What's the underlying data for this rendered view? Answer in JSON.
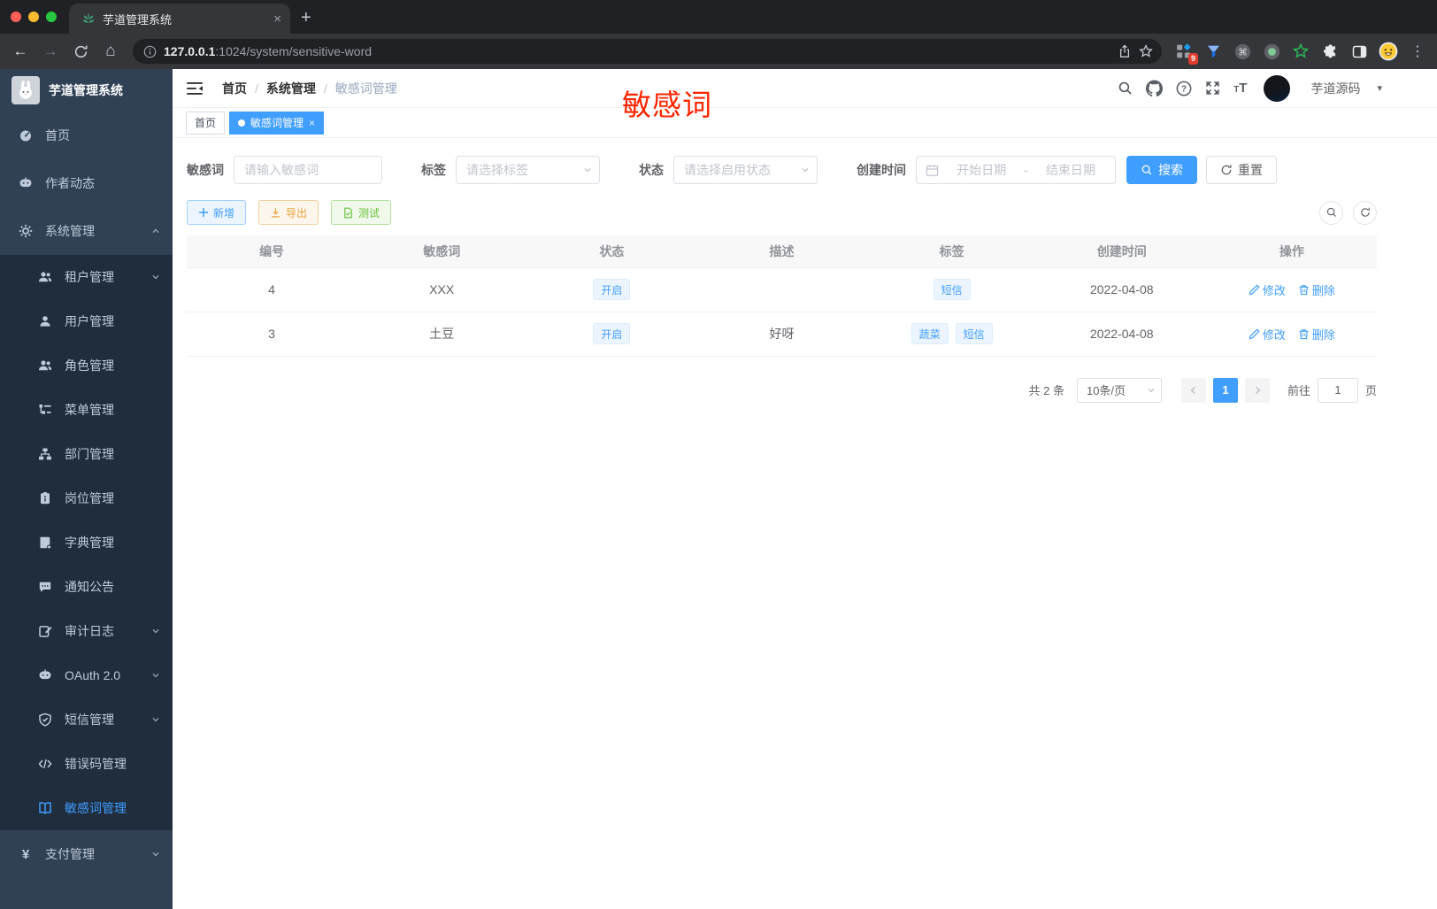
{
  "browser": {
    "tab_title": "芋道管理系统",
    "url_host": "127.0.0.1",
    "url_rest": ":1024/system/sensitive-word",
    "extension_badge": "9",
    "extension_icons": [
      "extensions-grid-icon",
      "funnel-icon",
      "command-circle-icon",
      "record-circle-icon",
      "green-star-icon",
      "puzzle-icon",
      "side-panel-icon",
      "profile-emoji-icon"
    ]
  },
  "sidebar": {
    "title": "芋道管理系统",
    "items": [
      {
        "label": "首页",
        "icon": "dashboard-icon",
        "level": 1,
        "chevron": "",
        "active": false
      },
      {
        "label": "作者动态",
        "icon": "message-icon",
        "level": 1,
        "chevron": "",
        "active": false
      },
      {
        "label": "系统管理",
        "icon": "gear-icon",
        "level": 1,
        "chevron": "up",
        "active": false
      },
      {
        "label": "租户管理",
        "icon": "users-icon",
        "level": 2,
        "chevron": "down",
        "active": false
      },
      {
        "label": "用户管理",
        "icon": "user-icon",
        "level": 2,
        "chevron": "",
        "active": false
      },
      {
        "label": "角色管理",
        "icon": "users-icon",
        "level": 2,
        "chevron": "",
        "active": false
      },
      {
        "label": "菜单管理",
        "icon": "tree-icon",
        "level": 2,
        "chevron": "",
        "active": false
      },
      {
        "label": "部门管理",
        "icon": "org-icon",
        "level": 2,
        "chevron": "",
        "active": false
      },
      {
        "label": "岗位管理",
        "icon": "badge-icon",
        "level": 2,
        "chevron": "",
        "active": false
      },
      {
        "label": "字典管理",
        "icon": "book-icon",
        "level": 2,
        "chevron": "",
        "active": false
      },
      {
        "label": "通知公告",
        "icon": "comment-icon",
        "level": 2,
        "chevron": "",
        "active": false
      },
      {
        "label": "审计日志",
        "icon": "edit-icon",
        "level": 2,
        "chevron": "down",
        "active": false
      },
      {
        "label": "OAuth 2.0",
        "icon": "message-icon",
        "level": 2,
        "chevron": "down",
        "active": false
      },
      {
        "label": "短信管理",
        "icon": "shield-icon",
        "level": 2,
        "chevron": "down",
        "active": false
      },
      {
        "label": "错误码管理",
        "icon": "code-icon",
        "level": 2,
        "chevron": "",
        "active": false
      },
      {
        "label": "敏感词管理",
        "icon": "open-book-icon",
        "level": 2,
        "chevron": "",
        "active": true
      },
      {
        "label": "支付管理",
        "icon": "yen-icon",
        "level": 1,
        "chevron": "down",
        "active": false
      }
    ]
  },
  "navbar": {
    "breadcrumb": [
      "首页",
      "系统管理",
      "敏感词管理"
    ],
    "right_icons": [
      "search-icon",
      "github-icon",
      "help-icon",
      "fullscreen-icon",
      "font-size-icon"
    ],
    "user_name": "芋道源码"
  },
  "annotation": {
    "text": "敏感词",
    "color": "#fe2500"
  },
  "tags_view": [
    {
      "label": "首页",
      "active": false,
      "closable": false
    },
    {
      "label": "敏感词管理",
      "active": true,
      "closable": true
    }
  ],
  "filters": {
    "keyword_label": "敏感词",
    "keyword_placeholder": "请输入敏感词",
    "tag_label": "标签",
    "tag_placeholder": "请选择标签",
    "status_label": "状态",
    "status_placeholder": "请选择启用状态",
    "date_label": "创建时间",
    "date_start_placeholder": "开始日期",
    "date_separator": "-",
    "date_end_placeholder": "结束日期",
    "search_label": "搜索",
    "reset_label": "重置"
  },
  "toolbar": {
    "add_label": "新增",
    "export_label": "导出",
    "test_label": "测试"
  },
  "table": {
    "headers": [
      "编号",
      "敏感词",
      "状态",
      "描述",
      "标签",
      "创建时间",
      "操作"
    ],
    "rows": [
      {
        "id": "4",
        "word": "XXX",
        "status": "开启",
        "description": "",
        "tags": [
          "短信"
        ],
        "created": "2022-04-08",
        "edit": "修改",
        "delete": "删除"
      },
      {
        "id": "3",
        "word": "土豆",
        "status": "开启",
        "description": "好呀",
        "tags": [
          "蔬菜",
          "短信"
        ],
        "created": "2022-04-08",
        "edit": "修改",
        "delete": "删除"
      }
    ]
  },
  "pagination": {
    "total": "共 2 条",
    "page_size": "10条/页",
    "current_page": "1",
    "goto_label": "前往",
    "goto_value": "1",
    "page_unit": "页"
  },
  "colors": {
    "primary": "#409eff",
    "sidebar_bg": "#304156",
    "submenu_bg": "#1f2d3d"
  }
}
